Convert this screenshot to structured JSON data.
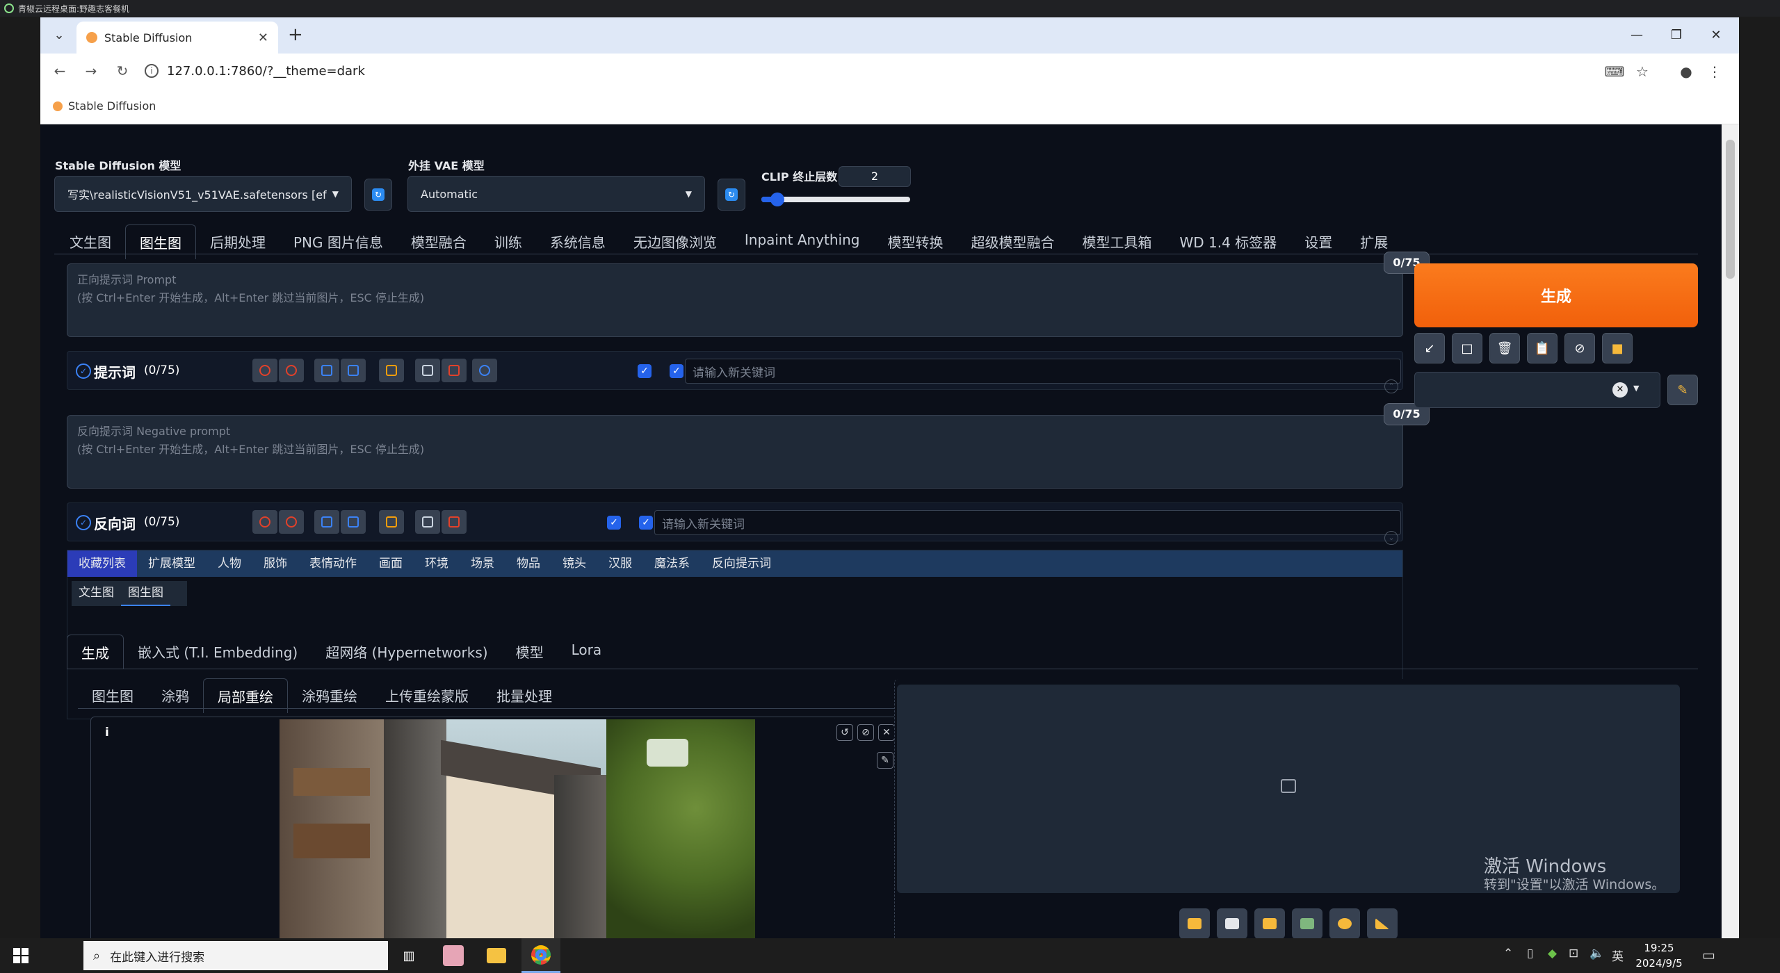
{
  "remote_title": "青椒云远程桌面:野趣志客餐机",
  "browser": {
    "tab_title": "Stable Diffusion",
    "url": "127.0.0.1:7860/?__theme=dark",
    "bookmark": "Stable Diffusion"
  },
  "models": {
    "sd_label": "Stable Diffusion 模型",
    "sd_value": "写实\\realisticVisionV51_v51VAE.safetensors [ef",
    "vae_label": "外挂 VAE 模型",
    "vae_value": "Automatic",
    "clip_label": "CLIP 终止层数",
    "clip_value": "2",
    "clip_fraction": 0.08
  },
  "main_tabs": [
    "文生图",
    "图生图",
    "后期处理",
    "PNG 图片信息",
    "模型融合",
    "训练",
    "系统信息",
    "无边图像浏览",
    "Inpaint Anything",
    "模型转换",
    "超级模型融合",
    "模型工具箱",
    "WD 1.4 标签器",
    "设置",
    "扩展"
  ],
  "prompt": {
    "placeholder_line1": "正向提示词 Prompt",
    "placeholder_line2": "(按 Ctrl+Enter 开始生成，Alt+Enter 跳过当前图片，ESC 停止生成)",
    "counter": "0/75",
    "section_label": "提示词",
    "section_count": "(0/75)",
    "keyword_placeholder": "请输入新关键词"
  },
  "negative": {
    "placeholder_line1": "反向提示词 Negative prompt",
    "placeholder_line2": "(按 Ctrl+Enter 开始生成，Alt+Enter 跳过当前图片，ESC 停止生成)",
    "counter": "0/75",
    "section_label": "反向词",
    "section_count": "(0/75)",
    "keyword_placeholder": "请输入新关键词"
  },
  "generate_label": "生成",
  "category_tabs": [
    "收藏列表",
    "扩展模型",
    "人物",
    "服饰",
    "表情动作",
    "画面",
    "环境",
    "场景",
    "物品",
    "镜头",
    "汉服",
    "魔法系",
    "反向提示词"
  ],
  "fav_subtabs": [
    "文生图",
    "图生图"
  ],
  "gen_tabs": [
    "生成",
    "嵌入式 (T.I. Embedding)",
    "超网络 (Hypernetworks)",
    "模型",
    "Lora"
  ],
  "img2img_tabs": [
    "图生图",
    "涂鸦",
    "局部重绘",
    "涂鸦重绘",
    "上传重绘蒙版",
    "批量处理"
  ],
  "info_glyph": "i",
  "watermark": {
    "line1": "激活 Windows",
    "line2": "转到\"设置\"以激活 Windows。"
  },
  "taskbar": {
    "search_placeholder": "在此键入进行搜索",
    "ime": "英",
    "time": "19:25",
    "date": "2024/9/5"
  }
}
